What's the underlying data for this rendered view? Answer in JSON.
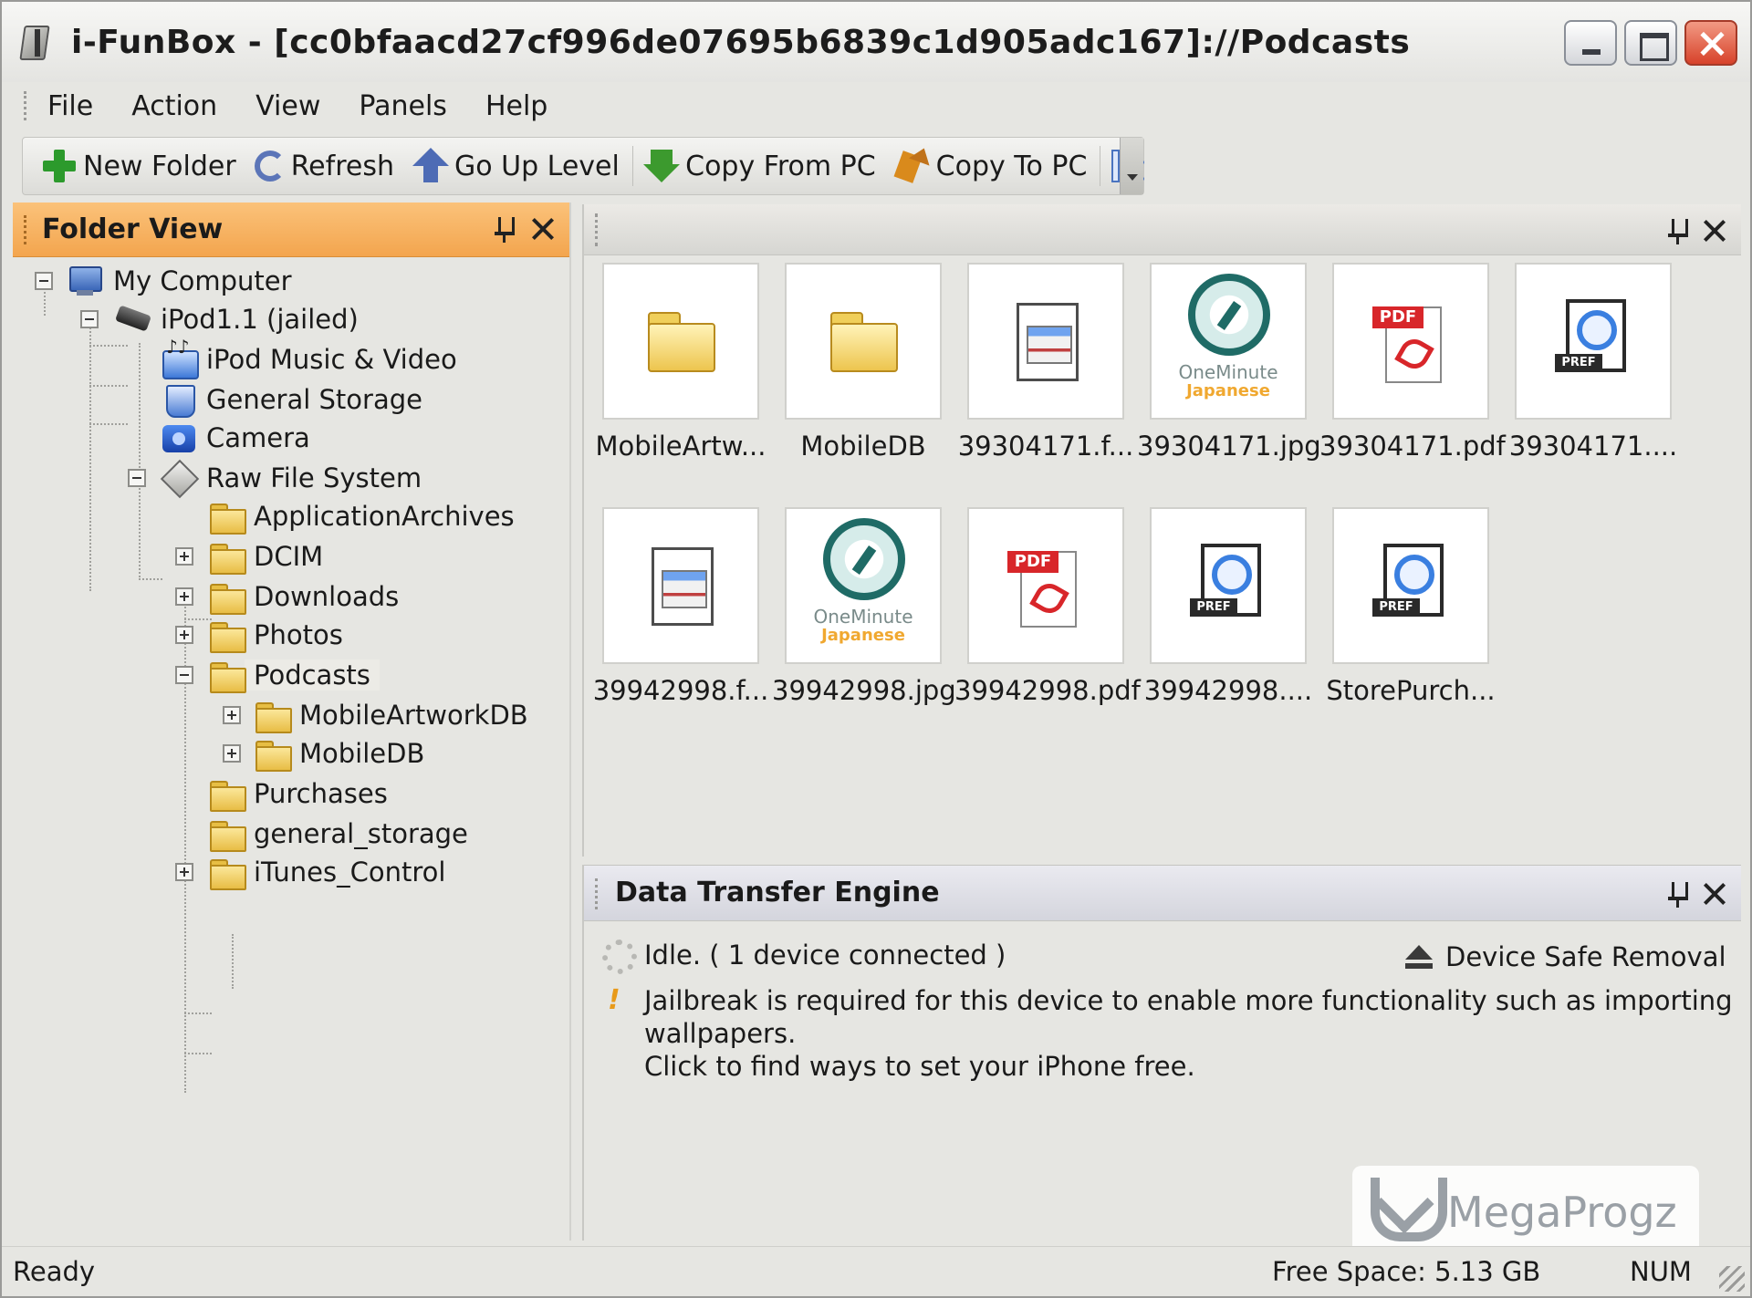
{
  "window": {
    "title": "i-FunBox - [cc0bfaacd27cf996de07695b6839c1d905adc167]://Podcasts"
  },
  "menu": {
    "items": [
      "File",
      "Action",
      "View",
      "Panels",
      "Help"
    ]
  },
  "toolbar": {
    "new_folder": "New Folder",
    "refresh": "Refresh",
    "go_up": "Go Up Level",
    "copy_from_pc": "Copy From PC",
    "copy_to_pc": "Copy To PC"
  },
  "folder_view": {
    "title": "Folder View",
    "tree": [
      {
        "label": "My Computer",
        "icon": "computer-icon",
        "expander": "minus"
      },
      {
        "label": "iPod1.1 (jailed)",
        "icon": "ipod-icon",
        "expander": "minus"
      },
      {
        "label": "iPod Music & Video",
        "icon": "music-video-icon"
      },
      {
        "label": "General Storage",
        "icon": "storage-icon"
      },
      {
        "label": "Camera",
        "icon": "camera-icon"
      },
      {
        "label": "Raw File System",
        "icon": "raw-file-system-icon",
        "expander": "minus"
      },
      {
        "label": "ApplicationArchives",
        "icon": "folder-icon"
      },
      {
        "label": "DCIM",
        "icon": "folder-icon",
        "expander": "plus"
      },
      {
        "label": "Downloads",
        "icon": "folder-icon",
        "expander": "plus"
      },
      {
        "label": "Photos",
        "icon": "folder-icon",
        "expander": "plus"
      },
      {
        "label": "Podcasts",
        "icon": "folder-icon",
        "expander": "minus",
        "selected": true
      },
      {
        "label": "MobileArtworkDB",
        "icon": "folder-icon",
        "expander": "plus"
      },
      {
        "label": "MobileDB",
        "icon": "folder-icon",
        "expander": "plus"
      },
      {
        "label": "Purchases",
        "icon": "folder-icon"
      },
      {
        "label": "general_storage",
        "icon": "folder-icon"
      },
      {
        "label": "iTunes_Control",
        "icon": "folder-icon",
        "expander": "plus"
      }
    ]
  },
  "files": {
    "items": [
      {
        "name": "MobileArtw...",
        "icon": "folder-icon"
      },
      {
        "name": "MobileDB",
        "icon": "folder-icon"
      },
      {
        "name": "39304171.f...",
        "icon": "document-icon"
      },
      {
        "name": "39304171.jpg",
        "icon": "one-minute-japanese-icon",
        "art_line1": "OneMinute",
        "art_line2": "Japanese"
      },
      {
        "name": "39304171.pdf",
        "icon": "pdf-icon",
        "tag": "PDF"
      },
      {
        "name": "39304171....",
        "icon": "quicktime-pref-icon",
        "tag": "PREF"
      },
      {
        "name": "39942998.f...",
        "icon": "document-icon"
      },
      {
        "name": "39942998.jpg",
        "icon": "one-minute-japanese-icon",
        "art_line1": "OneMinute",
        "art_line2": "Japanese"
      },
      {
        "name": "39942998.pdf",
        "icon": "pdf-icon",
        "tag": "PDF"
      },
      {
        "name": "39942998....",
        "icon": "quicktime-pref-icon",
        "tag": "PREF"
      },
      {
        "name": "StorePurch...",
        "icon": "quicktime-pref-icon",
        "tag": "PREF"
      }
    ]
  },
  "data_transfer": {
    "title": "Data Transfer Engine",
    "status": "Idle. ( 1 device connected )",
    "safe_removal": "Device Safe Removal",
    "jailbreak_line1": "Jailbreak is required for this device to enable more functionality such as importing",
    "jailbreak_line2": "wallpapers.",
    "jailbreak_line3": "Click to find ways to set your iPhone free."
  },
  "watermark": {
    "text": "MegaProgz"
  },
  "statusbar": {
    "ready": "Ready",
    "free_space": "Free Space: 5.13 GB",
    "num": "NUM"
  },
  "colors": {
    "folder_header": "#f3a54e",
    "window_bg": "#e6e6e2",
    "close_button": "#d7422a"
  }
}
